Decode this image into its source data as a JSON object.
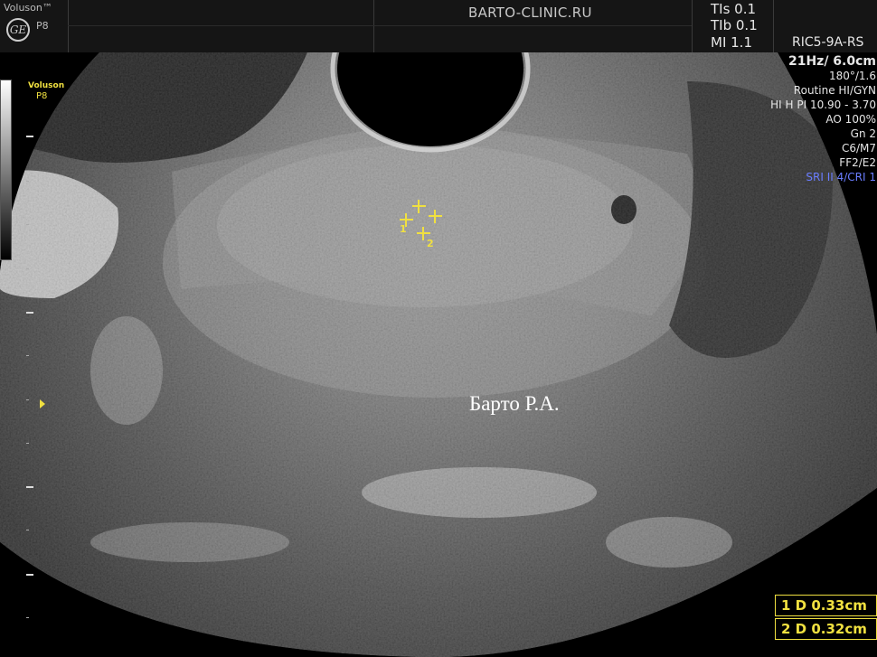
{
  "header": {
    "brand": "Voluson™",
    "probe_short": "P8",
    "clinic": "BARTO-CLINIC.RU",
    "tis": "TIs 0.1",
    "tib": "TIb 0.1",
    "mi": "MI 1.1",
    "probe_name": "RIC5-9A-RS"
  },
  "scale": {
    "brand": "Voluson",
    "preset": "P8"
  },
  "params": [
    "21Hz/ 6.0cm",
    "180°/1.6",
    "Routine HI/GYN",
    "HI H PI 10.90 - 3.70",
    "AO 100%",
    "Gn  2",
    "C6/M7",
    "FF2/E2",
    "SRI II 4/CRI 1"
  ],
  "watermark": "Барто Р.А.",
  "calipers": [
    {
      "label": "1"
    },
    {
      "label": "2"
    }
  ],
  "measurements": [
    {
      "text": "1  D 0.33cm"
    },
    {
      "text": "2  D 0.32cm"
    }
  ],
  "colors": {
    "caliper": "#f0e040",
    "sri": "#6a7dff",
    "header_bg": "#151515"
  }
}
